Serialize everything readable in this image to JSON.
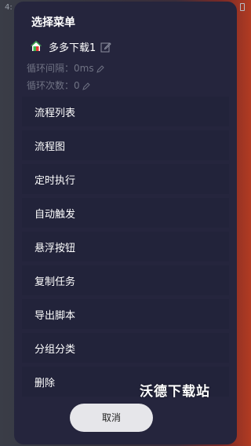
{
  "statusbar": {
    "time": "4:",
    "battery_icon": "battery-icon"
  },
  "sheet": {
    "title": "选择菜单",
    "task": {
      "name": "多多下载1",
      "icon": "home-icon",
      "edit_icon": "edit-icon"
    },
    "loop_interval": "循环间隔：0ms",
    "loop_count": "循环次数：0",
    "menu": [
      "流程列表",
      "流程图",
      "定时执行",
      "自动触发",
      "悬浮按钮",
      "复制任务",
      "导出脚本",
      "分组分类",
      "删除"
    ],
    "cancel_label": "取消"
  },
  "watermark": "沃德下载站",
  "colors": {
    "sheet_bg": "#25253d",
    "accent_red": "#b13b22",
    "cancel_bg": "#e6e6ea"
  }
}
